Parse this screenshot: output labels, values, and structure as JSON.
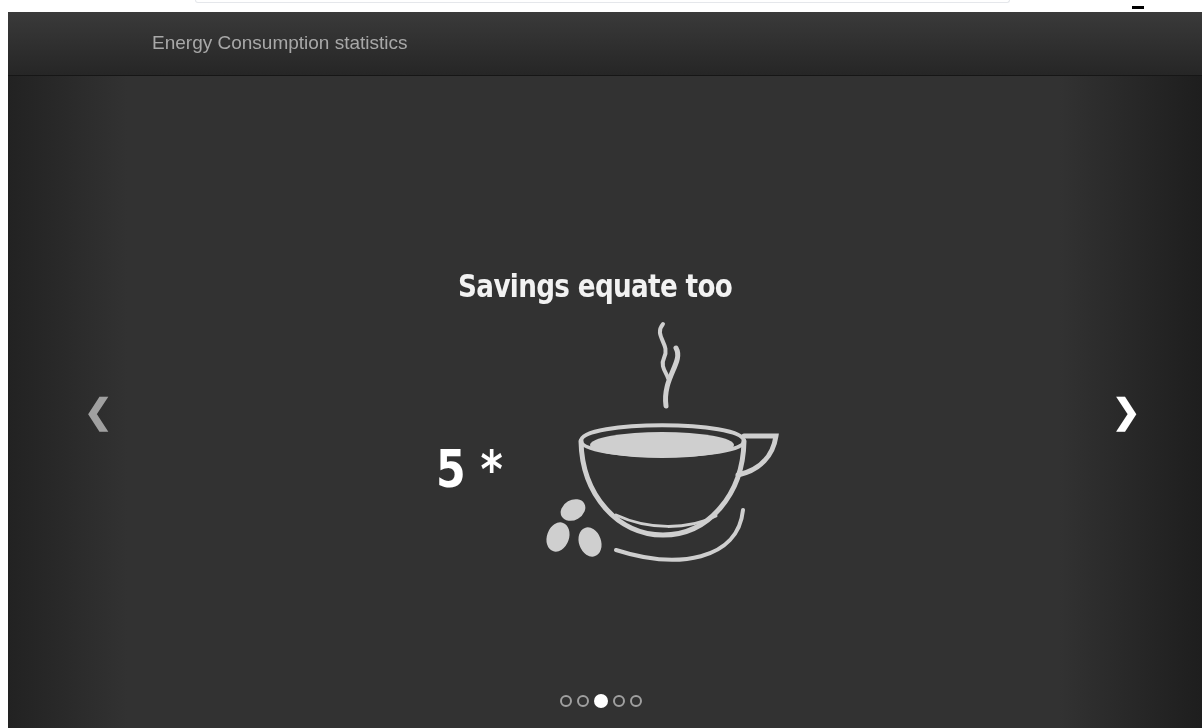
{
  "header": {
    "title": "Energy Consumption statistics"
  },
  "slide": {
    "title": "Savings equate too",
    "amount": "5 *"
  },
  "carousel": {
    "prev": "❮",
    "next": "❯",
    "dots": [
      {
        "selected": false
      },
      {
        "selected": false
      },
      {
        "selected": true
      },
      {
        "selected": false
      },
      {
        "selected": false
      }
    ]
  }
}
